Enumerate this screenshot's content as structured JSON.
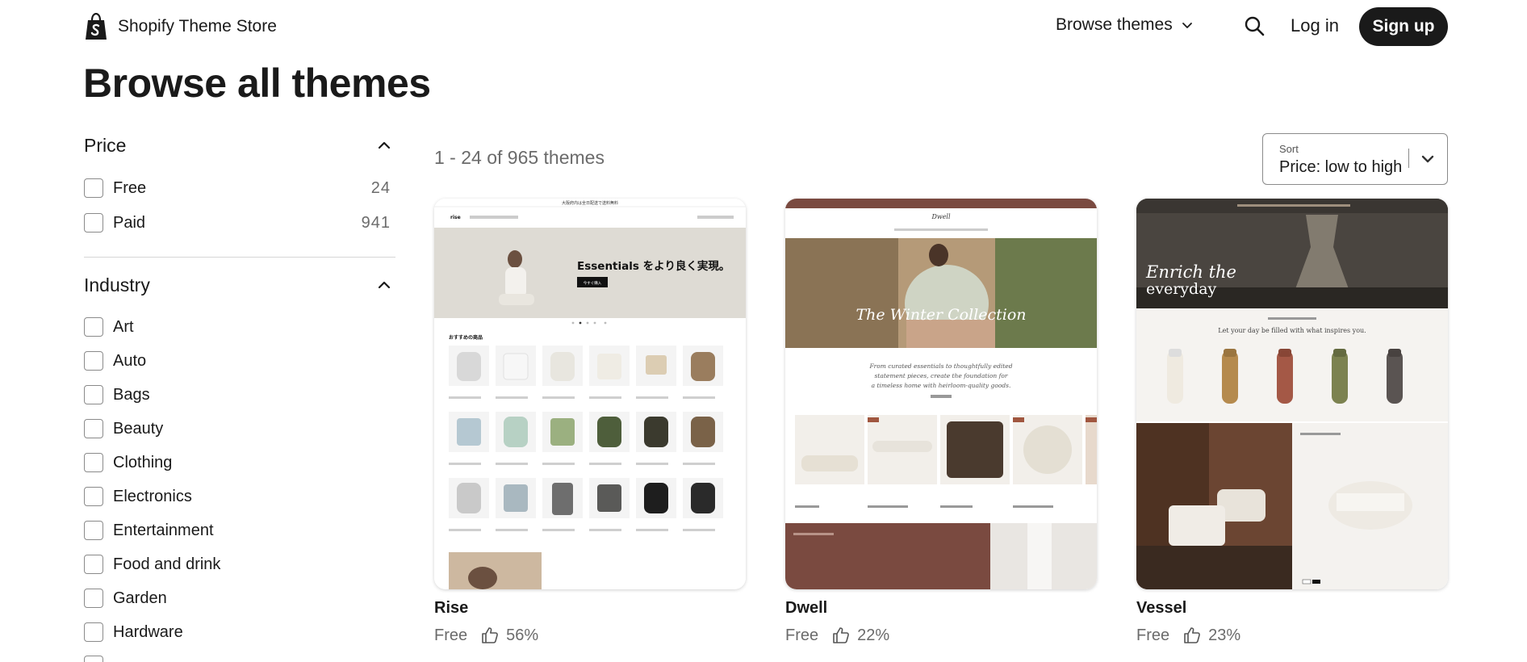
{
  "header": {
    "brand": "Shopify Theme Store",
    "browse_label": "Browse themes",
    "login_label": "Log in",
    "signup_label": "Sign up"
  },
  "page_title": "Browse all themes",
  "filters": {
    "price": {
      "title": "Price",
      "options": [
        {
          "label": "Free",
          "count": "24"
        },
        {
          "label": "Paid",
          "count": "941"
        }
      ]
    },
    "industry": {
      "title": "Industry",
      "options": [
        {
          "label": "Art"
        },
        {
          "label": "Auto"
        },
        {
          "label": "Bags"
        },
        {
          "label": "Beauty"
        },
        {
          "label": "Clothing"
        },
        {
          "label": "Electronics"
        },
        {
          "label": "Entertainment"
        },
        {
          "label": "Food and drink"
        },
        {
          "label": "Garden"
        },
        {
          "label": "Hardware"
        }
      ]
    }
  },
  "results": {
    "count_text": "1 - 24 of 965 themes",
    "sort_label": "Sort",
    "sort_value": "Price: low to high"
  },
  "themes": [
    {
      "name": "Rise",
      "price": "Free",
      "rating": "56%",
      "preview": {
        "announcement": "大阪府内は全日配送で送料無料",
        "hero_text": "Essentials をより良く実現。",
        "cta": "今すぐ購入",
        "section_title": "おすすめの商品",
        "logo": "rise"
      }
    },
    {
      "name": "Dwell",
      "price": "Free",
      "rating": "22%",
      "preview": {
        "logo": "Dwell",
        "hero_text": "The Winter Collection",
        "tagline_1": "From curated essentials to thoughtfully edited",
        "tagline_2": "statement pieces, create the foundation for",
        "tagline_3": "a timeless home with heirloom-quality goods."
      }
    },
    {
      "name": "Vessel",
      "price": "Free",
      "rating": "23%",
      "preview": {
        "hero_text_1": "Enrich the",
        "hero_text_2": "everyday",
        "tagline": "Let your day be filled with what inspires you."
      }
    }
  ],
  "colors": {
    "text": "#1a1a1a",
    "muted": "#6b6b6b",
    "button_bg": "#1a1a1a",
    "dwell_accent": "#7a4a40"
  }
}
